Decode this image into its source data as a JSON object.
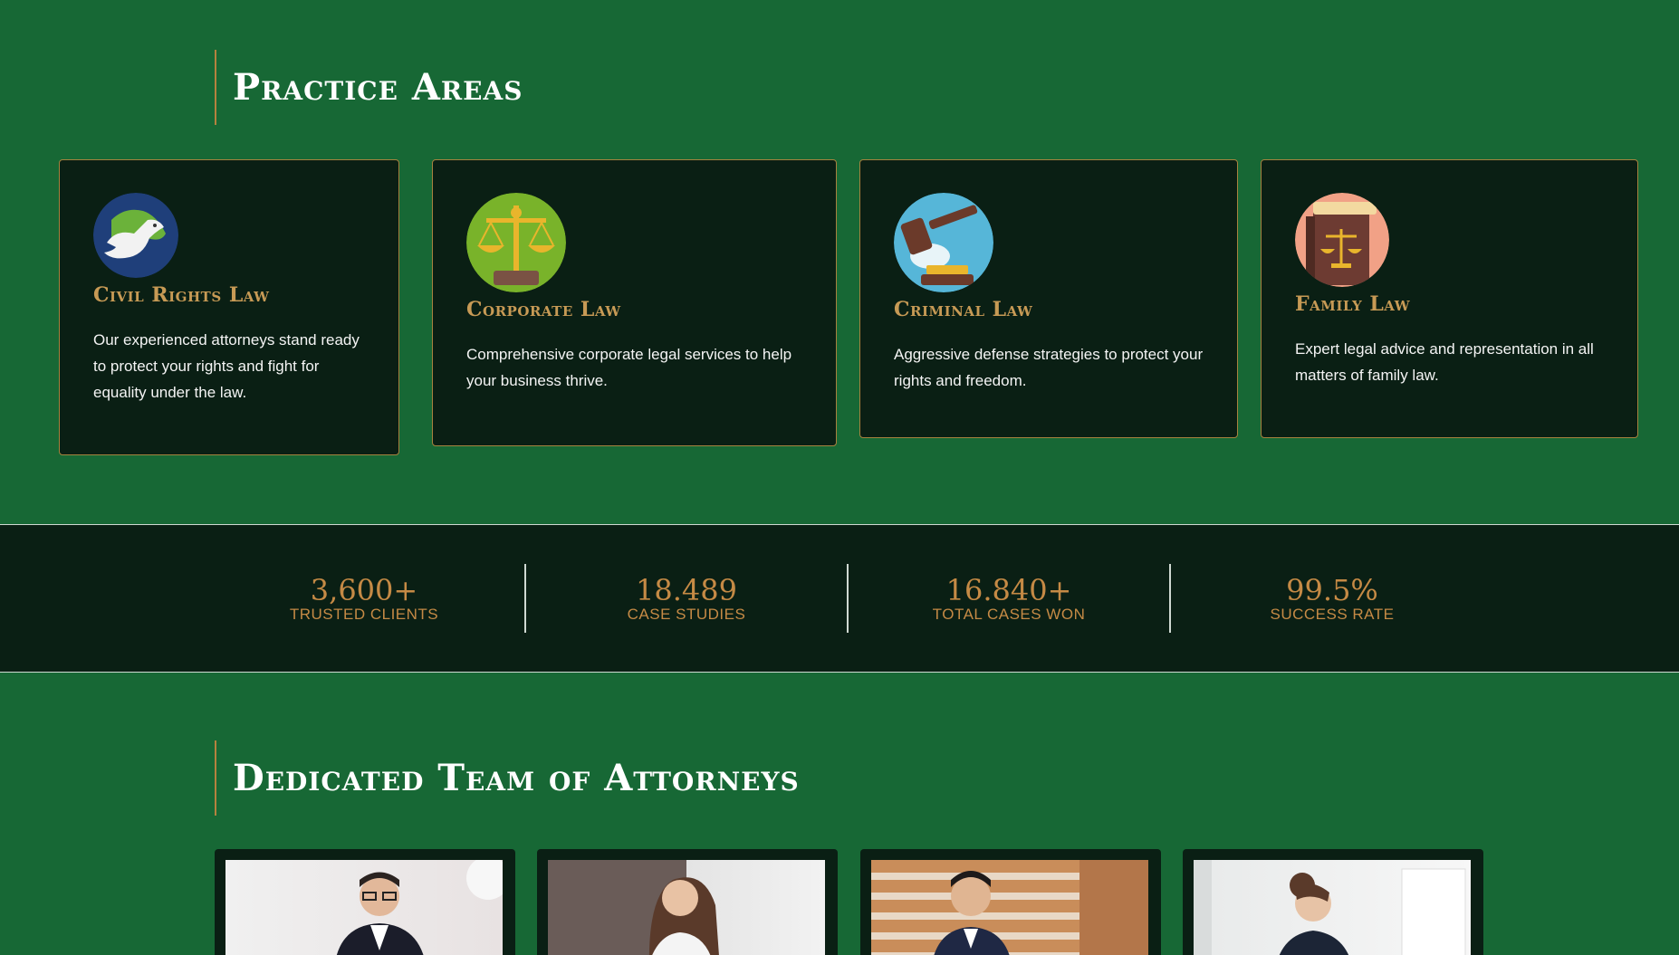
{
  "practice": {
    "heading": "Practice Areas",
    "cards": [
      {
        "title": "Civil Rights Law",
        "description": "Our experienced attorneys stand ready to protect your rights and fight for equality under the law.",
        "icon": "dove-globe-icon"
      },
      {
        "title": "Corporate Law",
        "description": "Comprehensive corporate legal services to help your business thrive.",
        "icon": "scales-icon"
      },
      {
        "title": "Criminal Law",
        "description": "Aggressive defense strategies to protect your rights and freedom.",
        "icon": "gavel-icon"
      },
      {
        "title": "Family Law",
        "description": "Expert legal advice and representation in all matters of family law.",
        "icon": "law-book-icon"
      }
    ]
  },
  "stats": [
    {
      "value": "3,600+",
      "label": "TRUSTED CLIENTS"
    },
    {
      "value": "18.489",
      "label": "CASE STUDIES"
    },
    {
      "value": "16.840+",
      "label": "TOTAL CASES WON"
    },
    {
      "value": "99.5%",
      "label": "SUCCESS RATE"
    }
  ],
  "team": {
    "heading": "Dedicated Team of Attorneys",
    "attorneys": [
      {
        "photo": "attorney-photo-man-glasses"
      },
      {
        "photo": "attorney-photo-woman-smiling"
      },
      {
        "photo": "attorney-photo-man-stairs"
      },
      {
        "photo": "attorney-photo-woman-profile"
      }
    ]
  },
  "colors": {
    "background": "#176835",
    "card": "#0a1f14",
    "accent": "#c79a55",
    "border": "#a7823f"
  }
}
